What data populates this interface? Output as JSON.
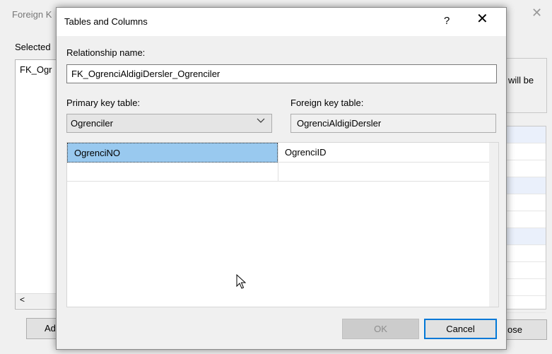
{
  "background_dialog": {
    "title": "Foreign K",
    "selected_label": "Selected",
    "list_item": "FK_Ogr",
    "scroll_left_glyph": "<",
    "add_button_label": "Ad",
    "right_text": "will be",
    "close_button_label": "ose",
    "close_icon": "close-icon"
  },
  "dialog": {
    "title": "Tables and Columns",
    "help_glyph": "?",
    "close_glyph": "✕",
    "relationship_name_label": "Relationship name:",
    "relationship_name_value": "FK_OgrenciAldigiDersler_Ogrenciler",
    "primary_key_table_label": "Primary key table:",
    "primary_key_table_value": "Ogrenciler",
    "foreign_key_table_label": "Foreign key table:",
    "foreign_key_table_value": "OgrenciAldigiDersler",
    "columns": [
      {
        "primary": "OgrenciNO",
        "foreign": "OgrenciID"
      },
      {
        "primary": "",
        "foreign": ""
      }
    ],
    "ok_label": "OK",
    "cancel_label": "Cancel"
  },
  "colors": {
    "selection": "#99c9ef",
    "focus_border": "#0078d7"
  }
}
